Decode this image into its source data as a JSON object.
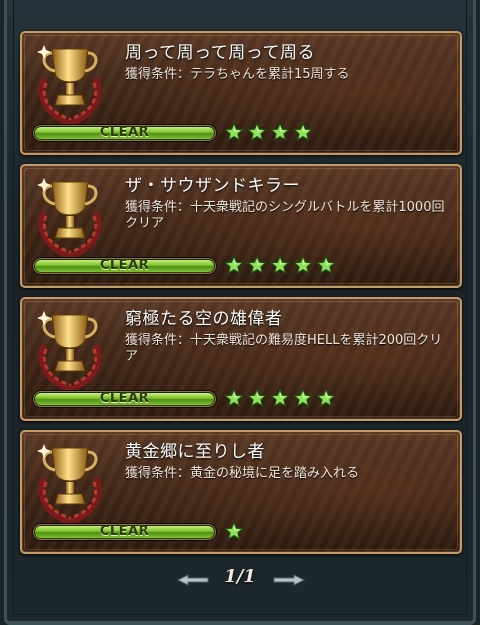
{
  "achievements": [
    {
      "title": "周って周って周って周る",
      "condition": "獲得条件：テラちゃんを累計15周する",
      "status": "CLEAR",
      "stars": 4
    },
    {
      "title": "ザ・サウザンドキラー",
      "condition": "獲得条件：十天衆戦記のシングルバトルを累計1000回クリア",
      "status": "CLEAR",
      "stars": 5
    },
    {
      "title": "窮極たる空の雄偉者",
      "condition": "獲得条件：十天衆戦記の難易度HELLを累計200回クリア",
      "status": "CLEAR",
      "stars": 5
    },
    {
      "title": "黄金郷に至りし者",
      "condition": "獲得条件：黄金の秘境に足を踏み入れる",
      "status": "CLEAR",
      "stars": 1
    }
  ],
  "pager": {
    "label": "1/1"
  },
  "colors": {
    "star": "#8fe25a",
    "clear_bar": "#7cc02c",
    "card_border": "#c49a66"
  },
  "icons": {
    "trophy": "trophy-icon",
    "star": "star-icon",
    "prev": "prev-page-arrow-icon",
    "next": "next-page-arrow-icon"
  }
}
